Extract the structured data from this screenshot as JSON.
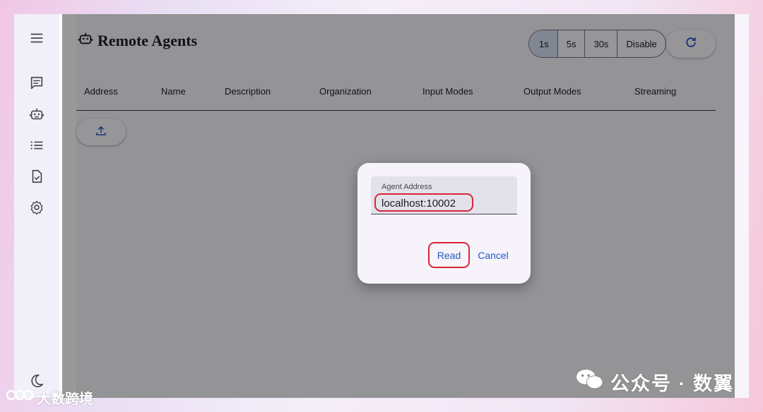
{
  "page": {
    "title": "Remote Agents"
  },
  "sidebar": {
    "items": [
      {
        "icon": "menu-icon"
      },
      {
        "icon": "chat-icon"
      },
      {
        "icon": "robot-icon"
      },
      {
        "icon": "list-icon"
      },
      {
        "icon": "task-check-icon"
      },
      {
        "icon": "settings-gear-icon"
      },
      {
        "icon": "dark-mode-moon-icon"
      }
    ]
  },
  "refresh": {
    "options": [
      "1s",
      "5s",
      "30s",
      "Disable"
    ],
    "selected": "1s",
    "button_icon": "refresh-icon"
  },
  "table": {
    "columns": [
      "Address",
      "Name",
      "Description",
      "Organization",
      "Input Modes",
      "Output Modes",
      "Streaming"
    ],
    "upload_icon": "upload-icon"
  },
  "dialog": {
    "field_label": "Agent Address",
    "field_value": "localhost:10002",
    "primary_button": "Read",
    "secondary_button": "Cancel"
  },
  "watermarks": {
    "right_text": "公众号 · 数翼",
    "left_text": "大数跨境"
  },
  "colors": {
    "accent": "#2458c4",
    "highlight_border": "#d8243a",
    "scrim": "#000000"
  }
}
